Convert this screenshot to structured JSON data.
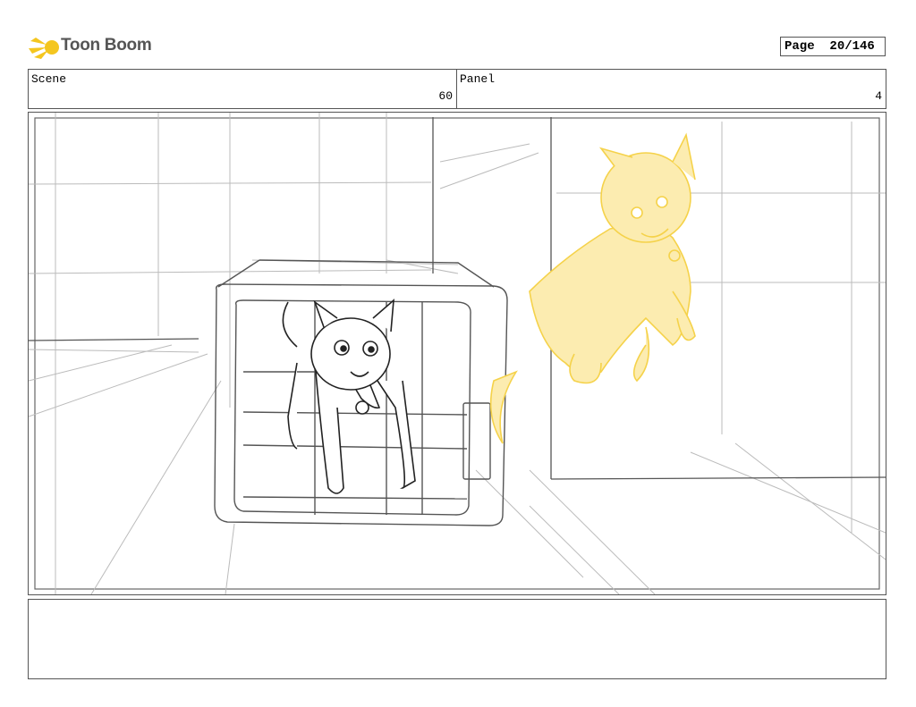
{
  "brand": {
    "name": "Toon Boom",
    "logo_color": "#f4c61f"
  },
  "page": {
    "label": "Page",
    "number": "20/146"
  },
  "scene": {
    "label": "Scene",
    "value": "60"
  },
  "panel": {
    "label": "Panel",
    "value": "4"
  },
  "drawing": {
    "sketch_colors": {
      "line": "#333333",
      "guides": "#b8b8b8",
      "highlight": "#f5d24a",
      "fill": "#fcecb0"
    }
  },
  "notes": {
    "text": ""
  }
}
